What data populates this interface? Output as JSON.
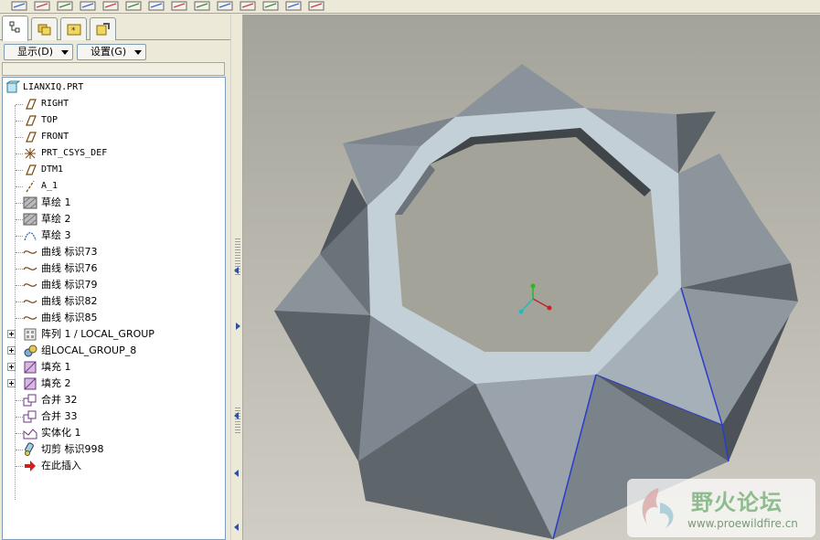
{
  "toolbar": {
    "buttons": [
      "datum-plane-icon",
      "datum-axis-icon",
      "sketch-curve-icon",
      "datum-point-icon",
      "curve-icon",
      "coordinate-system-icon",
      "analysis-icon",
      "delete-icon",
      "view-manager-icon",
      "saved-views-icon",
      "shading-icon",
      "appearance-icon",
      "layers-icon",
      "settings-icon"
    ]
  },
  "panel": {
    "tabs": [
      {
        "name": "model-tree-tab",
        "icon": "model-tree-icon",
        "active": true
      },
      {
        "name": "folder-browser-tab",
        "icon": "folder-icon",
        "active": false
      },
      {
        "name": "favorites-tab",
        "icon": "favorites-icon",
        "active": false
      },
      {
        "name": "connections-tab",
        "icon": "connections-icon",
        "active": false
      }
    ],
    "show_label": "显示(D)",
    "settings_label": "设置(G)"
  },
  "tree": {
    "root": {
      "label": "LIANXIQ.PRT",
      "icon": "part-icon"
    },
    "items": [
      {
        "label": "RIGHT",
        "icon": "datum-plane-icon",
        "expandable": false
      },
      {
        "label": "TOP",
        "icon": "datum-plane-icon",
        "expandable": false
      },
      {
        "label": "FRONT",
        "icon": "datum-plane-icon",
        "expandable": false
      },
      {
        "label": "PRT_CSYS_DEF",
        "icon": "coordinate-system-icon",
        "expandable": false
      },
      {
        "label": "DTM1",
        "icon": "datum-plane-icon",
        "expandable": false
      },
      {
        "label": "A_1",
        "icon": "datum-axis-icon",
        "expandable": false
      },
      {
        "label": "草绘 1",
        "icon": "sketch-icon",
        "expandable": false
      },
      {
        "label": "草绘 2",
        "icon": "sketch-icon",
        "expandable": false
      },
      {
        "label": "草绘 3",
        "icon": "sketch-curve-icon",
        "expandable": false
      },
      {
        "label": "曲线 标识73",
        "icon": "curve-icon",
        "expandable": false
      },
      {
        "label": "曲线 标识76",
        "icon": "curve-icon",
        "expandable": false
      },
      {
        "label": "曲线 标识79",
        "icon": "curve-icon",
        "expandable": false
      },
      {
        "label": "曲线 标识82",
        "icon": "curve-icon",
        "expandable": false
      },
      {
        "label": "曲线 标识85",
        "icon": "curve-icon",
        "expandable": false
      },
      {
        "label": "阵列 1 / LOCAL_GROUP",
        "icon": "pattern-icon",
        "expandable": true
      },
      {
        "label": "组LOCAL_GROUP_8",
        "icon": "group-icon",
        "expandable": true
      },
      {
        "label": "填充 1",
        "icon": "fill-icon",
        "expandable": true
      },
      {
        "label": "填充 2",
        "icon": "fill-icon",
        "expandable": true
      },
      {
        "label": "合并 32",
        "icon": "merge-icon",
        "expandable": false
      },
      {
        "label": "合并 33",
        "icon": "merge-icon",
        "expandable": false
      },
      {
        "label": "实体化 1",
        "icon": "solidify-icon",
        "expandable": false
      },
      {
        "label": "切剪 标识998",
        "icon": "cut-icon",
        "expandable": false
      },
      {
        "label": "在此插入",
        "icon": "insert-here-icon",
        "expandable": false
      }
    ]
  },
  "watermark": {
    "title": "野火论坛",
    "url": "www.proewildfire.cn"
  },
  "colors": {
    "surface_light": "#c4d0d8",
    "surface_mid": "#8a929a",
    "surface_dark": "#4c5258",
    "edge_highlight": "#2a3ccc",
    "background_top": "#a4a39a",
    "background_bottom": "#d0cec4"
  }
}
